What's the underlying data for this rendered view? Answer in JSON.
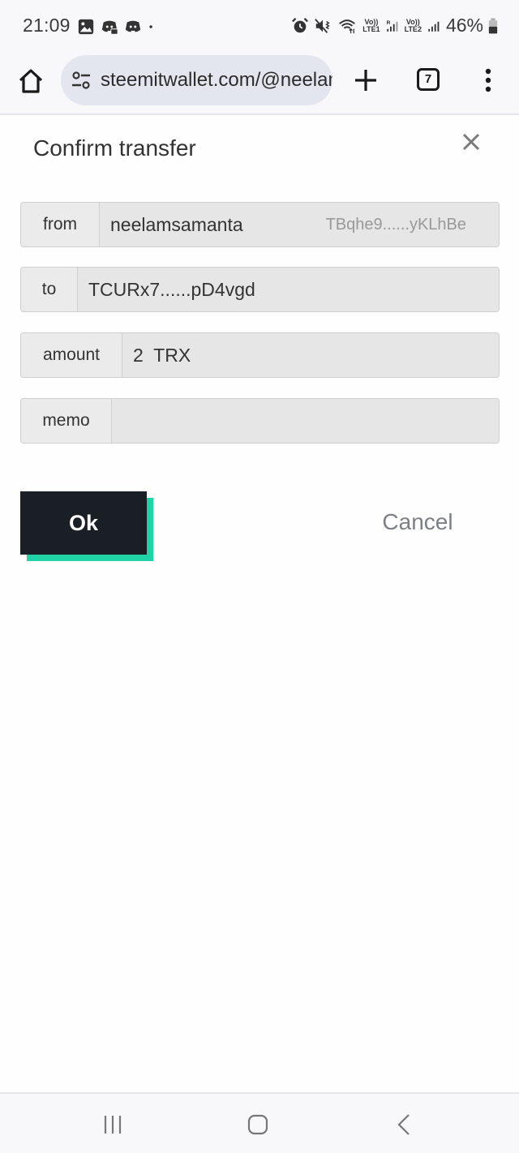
{
  "status_bar": {
    "time": "21:09",
    "left_icons": [
      "gallery-icon",
      "discord-notification-icon",
      "discord-icon",
      "dot-icon"
    ],
    "right_icons": [
      "alarm-icon",
      "vibrate-mute-icon",
      "wifi-icon",
      "volte-lte1-icon",
      "signal-roaming-icon",
      "volte-lte2-icon",
      "signal-icon",
      "battery-icon"
    ],
    "lte1_label": "Vo)) LTE1",
    "lte2_label": "Vo)) LTE2",
    "roaming": "R",
    "battery_percent": "46%"
  },
  "browser": {
    "url": "steemitwallet.com/@neelamsamanta",
    "tab_count": "7"
  },
  "dialog": {
    "title": "Confirm transfer",
    "fields": [
      {
        "label": "from",
        "value": "neelamsamanta",
        "hint": "TBqhe9......yKLhBe"
      },
      {
        "label": "to",
        "value": "TCURx7......pD4vgd"
      },
      {
        "label": "amount",
        "value": "2  TRX"
      },
      {
        "label": "memo",
        "value": ""
      }
    ],
    "ok_label": "Ok",
    "cancel_label": "Cancel"
  },
  "colors": {
    "ok_bg": "#1a1f26",
    "ok_accent": "#1fd3a6",
    "cancel_text": "#7c7f85"
  }
}
